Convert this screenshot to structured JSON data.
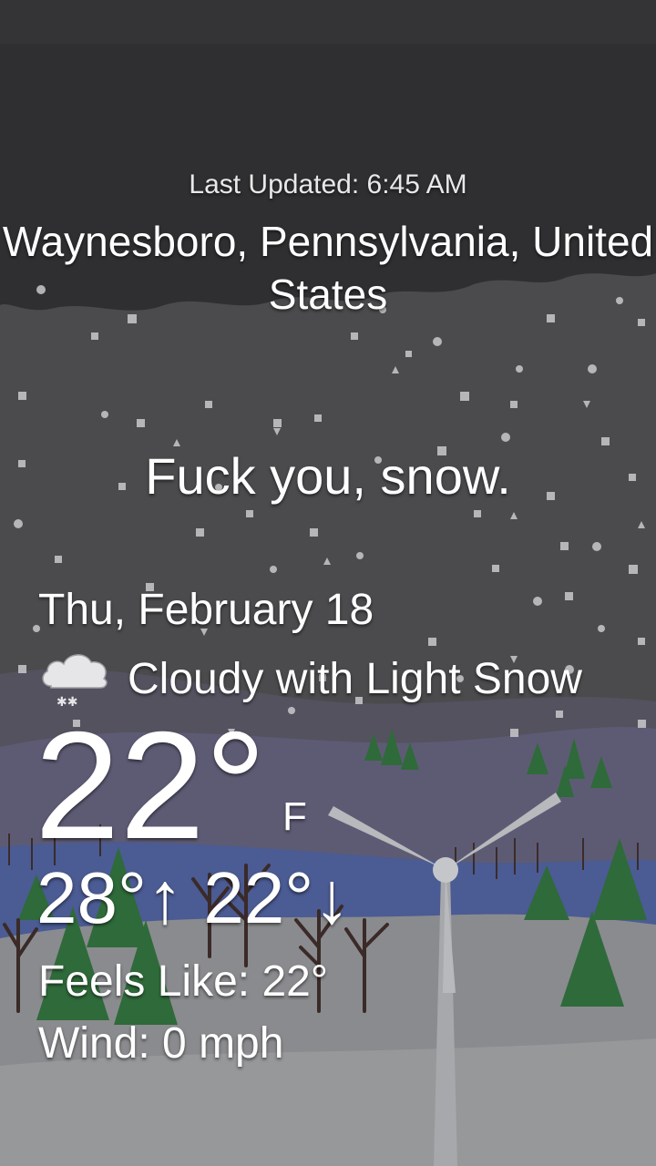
{
  "status_bar": {},
  "weather": {
    "last_updated": "Last Updated: 6:45 AM",
    "location": "Waynesboro, Pennsylvania, United States",
    "message": "Fuck you, snow.",
    "date": "Thu, February 18",
    "condition": "Cloudy with Light Snow",
    "condition_icon": "cloud-snow-icon",
    "temperature": "22°",
    "unit": "F",
    "high_low": "28°↑ 22°↓",
    "feels_like": "Feels Like: 22°",
    "wind": "Wind: 0 mph"
  },
  "colors": {
    "sky": "#4a4a4c",
    "cloud_band": "#2e2e30",
    "hill_purple": "#5a5870",
    "hill_blue": "#4a5a90",
    "snow_ground": "#88898c",
    "tree_green": "#2f6a3a",
    "text": "#ffffff"
  }
}
